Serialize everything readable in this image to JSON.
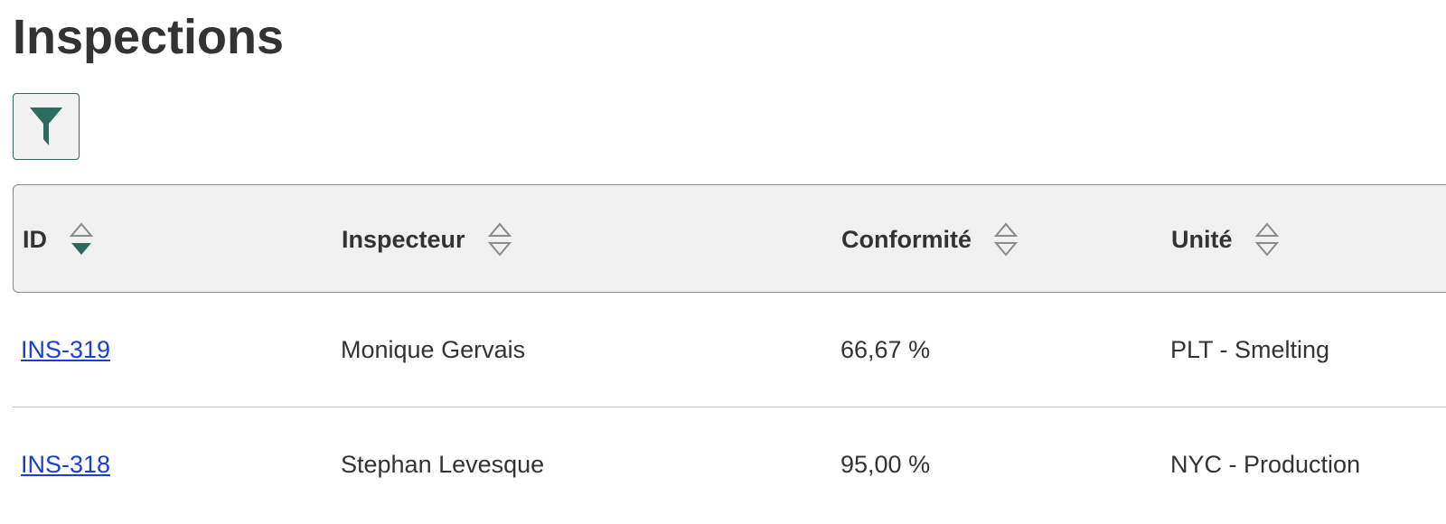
{
  "page": {
    "title": "Inspections"
  },
  "toolbar": {
    "filter_icon": "filter-icon"
  },
  "table": {
    "columns": [
      {
        "label": "ID",
        "sort": "descending"
      },
      {
        "label": "Inspecteur",
        "sort": "none"
      },
      {
        "label": "Conformité",
        "sort": "none"
      },
      {
        "label": "Unité",
        "sort": "none"
      }
    ],
    "rows": [
      {
        "id": "INS-319",
        "inspector": "Monique Gervais",
        "compliance": "66,67 %",
        "unit": "PLT - Smelting"
      },
      {
        "id": "INS-318",
        "inspector": "Stephan Levesque",
        "compliance": "95,00 %",
        "unit": "NYC - Production"
      }
    ]
  },
  "colors": {
    "accent": "#2d6b62",
    "link": "#1a3fd6",
    "header_bg": "#f0f0f0"
  }
}
